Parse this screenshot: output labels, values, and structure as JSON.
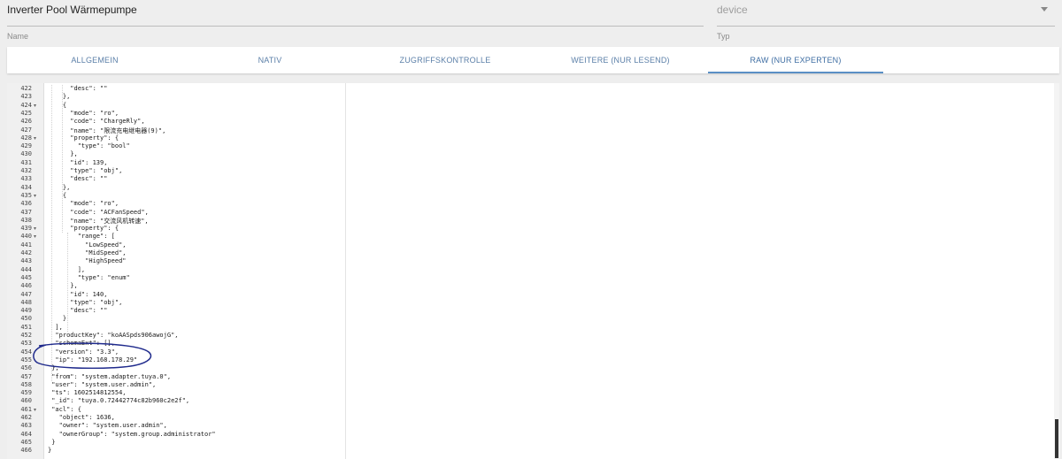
{
  "name_field": {
    "value": "Inverter Pool Wärmepumpe",
    "label": "Name"
  },
  "type_field": {
    "value": "device",
    "label": "Typ"
  },
  "tabs": [
    {
      "label": "ALLGEMEIN",
      "active": false
    },
    {
      "label": "NATIV",
      "active": false
    },
    {
      "label": "ZUGRIFFSKONTROLLE",
      "active": false
    },
    {
      "label": "WEITERE (NUR LESEND)",
      "active": false
    },
    {
      "label": "RAW (NUR EXPERTEN)",
      "active": true
    }
  ],
  "colors": {
    "tab_text": "#5b7fa8",
    "tab_active_underline": "#5a8fc5",
    "annotation_ring": "#1f2a8c"
  },
  "editor": {
    "lines": [
      {
        "n": "422",
        "fold": false,
        "text": "      \"desc\": \"\""
      },
      {
        "n": "423",
        "fold": false,
        "text": "    },"
      },
      {
        "n": "424",
        "fold": true,
        "text": "    {"
      },
      {
        "n": "425",
        "fold": false,
        "text": "      \"mode\": \"ro\","
      },
      {
        "n": "426",
        "fold": false,
        "text": "      \"code\": \"ChargeRly\","
      },
      {
        "n": "427",
        "fold": false,
        "text": "      \"name\": \"限流充电继电器(9)\","
      },
      {
        "n": "428",
        "fold": true,
        "text": "      \"property\": {"
      },
      {
        "n": "429",
        "fold": false,
        "text": "        \"type\": \"bool\""
      },
      {
        "n": "430",
        "fold": false,
        "text": "      },"
      },
      {
        "n": "431",
        "fold": false,
        "text": "      \"id\": 139,"
      },
      {
        "n": "432",
        "fold": false,
        "text": "      \"type\": \"obj\","
      },
      {
        "n": "433",
        "fold": false,
        "text": "      \"desc\": \"\""
      },
      {
        "n": "434",
        "fold": false,
        "text": "    },"
      },
      {
        "n": "435",
        "fold": true,
        "text": "    {"
      },
      {
        "n": "436",
        "fold": false,
        "text": "      \"mode\": \"ro\","
      },
      {
        "n": "437",
        "fold": false,
        "text": "      \"code\": \"ACFanSpeed\","
      },
      {
        "n": "438",
        "fold": false,
        "text": "      \"name\": \"交流风机转速\","
      },
      {
        "n": "439",
        "fold": true,
        "text": "      \"property\": {"
      },
      {
        "n": "440",
        "fold": true,
        "text": "        \"range\": ["
      },
      {
        "n": "441",
        "fold": false,
        "text": "          \"LowSpeed\","
      },
      {
        "n": "442",
        "fold": false,
        "text": "          \"MidSpeed\","
      },
      {
        "n": "443",
        "fold": false,
        "text": "          \"HighSpeed\""
      },
      {
        "n": "444",
        "fold": false,
        "text": "        ],"
      },
      {
        "n": "445",
        "fold": false,
        "text": "        \"type\": \"enum\""
      },
      {
        "n": "446",
        "fold": false,
        "text": "      },"
      },
      {
        "n": "447",
        "fold": false,
        "text": "      \"id\": 140,"
      },
      {
        "n": "448",
        "fold": false,
        "text": "      \"type\": \"obj\","
      },
      {
        "n": "449",
        "fold": false,
        "text": "      \"desc\": \"\""
      },
      {
        "n": "450",
        "fold": false,
        "text": "    }"
      },
      {
        "n": "451",
        "fold": false,
        "text": "  ],"
      },
      {
        "n": "452",
        "fold": false,
        "text": "  \"productKey\": \"koAASpds906awojG\","
      },
      {
        "n": "453",
        "fold": false,
        "text": "  \"schemaExt\": [],"
      },
      {
        "n": "454",
        "fold": false,
        "text": "  \"version\": \"3.3\","
      },
      {
        "n": "455",
        "fold": false,
        "text": "  \"ip\": \"192.168.178.29\""
      },
      {
        "n": "456",
        "fold": false,
        "text": " },"
      },
      {
        "n": "457",
        "fold": false,
        "text": " \"from\": \"system.adapter.tuya.0\","
      },
      {
        "n": "458",
        "fold": false,
        "text": " \"user\": \"system.user.admin\","
      },
      {
        "n": "459",
        "fold": false,
        "text": " \"ts\": 1602514812554,"
      },
      {
        "n": "460",
        "fold": false,
        "text": " \"_id\": \"tuya.0.72442774c82b960c2e2f\","
      },
      {
        "n": "461",
        "fold": true,
        "text": " \"acl\": {"
      },
      {
        "n": "462",
        "fold": false,
        "text": "   \"object\": 1636,"
      },
      {
        "n": "463",
        "fold": false,
        "text": "   \"owner\": \"system.user.admin\","
      },
      {
        "n": "464",
        "fold": false,
        "text": "   \"ownerGroup\": \"system.group.administrator\""
      },
      {
        "n": "465",
        "fold": false,
        "text": " }"
      },
      {
        "n": "466",
        "fold": false,
        "text": "}"
      }
    ]
  }
}
